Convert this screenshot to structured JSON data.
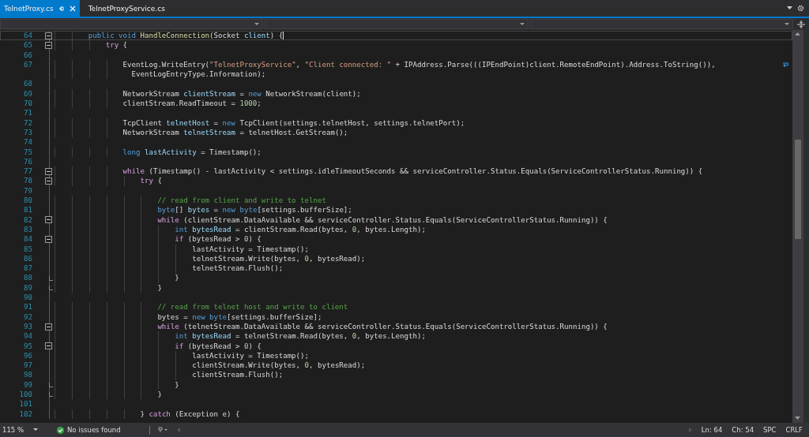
{
  "tabs": [
    {
      "label": "TelnetProxy.cs",
      "selected": true
    },
    {
      "label": "TelnetProxyService.cs",
      "selected": false
    }
  ],
  "editor": {
    "lines": [
      {
        "number": "64",
        "collapsible": true,
        "current": true,
        "tokens": [
          {
            "kind": "keyword",
            "text": "        public void "
          },
          {
            "kind": "method",
            "text": "HandleConnection"
          },
          {
            "kind": "plain",
            "text": "(Socket "
          },
          {
            "kind": "local",
            "text": "client"
          },
          {
            "kind": "plain",
            "text": ") {"
          }
        ]
      },
      {
        "number": "65",
        "collapsible": true,
        "tokens": [
          {
            "kind": "control",
            "text": "            try"
          },
          {
            "kind": "plain",
            "text": " {"
          }
        ]
      },
      {
        "number": "66"
      },
      {
        "number": "67",
        "wrapped": true,
        "tokens": [
          {
            "kind": "plain",
            "text": "                EventLog.WriteEntry("
          },
          {
            "kind": "string",
            "text": "\"TelnetProxyService\""
          },
          {
            "kind": "plain",
            "text": ", "
          },
          {
            "kind": "string",
            "text": "\"Client connected: \""
          },
          {
            "kind": "plain",
            "text": " + IPAddress.Parse(((IPEndPoint)client.RemoteEndPoint).Address.ToString()),"
          }
        ],
        "continuation": "                  EventLogEntryType.Information);"
      },
      {
        "number": "68"
      },
      {
        "number": "69",
        "tokens": [
          {
            "kind": "plain",
            "text": "                NetworkStream "
          },
          {
            "kind": "local",
            "text": "clientStream"
          },
          {
            "kind": "plain",
            "text": " = "
          },
          {
            "kind": "keyword",
            "text": "new"
          },
          {
            "kind": "plain",
            "text": " NetworkStream(client);"
          }
        ]
      },
      {
        "number": "70",
        "tokens": [
          {
            "kind": "plain",
            "text": "                clientStream.ReadTimeout = "
          },
          {
            "kind": "number",
            "text": "1000"
          },
          {
            "kind": "plain",
            "text": ";"
          }
        ]
      },
      {
        "number": "71"
      },
      {
        "number": "72",
        "tokens": [
          {
            "kind": "plain",
            "text": "                TcpClient "
          },
          {
            "kind": "local",
            "text": "telnetHost"
          },
          {
            "kind": "plain",
            "text": " = "
          },
          {
            "kind": "keyword",
            "text": "new"
          },
          {
            "kind": "plain",
            "text": " TcpClient(settings.telnetHost, settings.telnetPort);"
          }
        ]
      },
      {
        "number": "73",
        "tokens": [
          {
            "kind": "plain",
            "text": "                NetworkStream "
          },
          {
            "kind": "local",
            "text": "telnetStream"
          },
          {
            "kind": "plain",
            "text": " = telnetHost.GetStream();"
          }
        ]
      },
      {
        "number": "74"
      },
      {
        "number": "75",
        "tokens": [
          {
            "kind": "keyword",
            "text": "                long "
          },
          {
            "kind": "local",
            "text": "lastActivity"
          },
          {
            "kind": "plain",
            "text": " = Timestamp();"
          }
        ]
      },
      {
        "number": "76"
      },
      {
        "number": "77",
        "collapsible": true,
        "tokens": [
          {
            "kind": "control",
            "text": "                while"
          },
          {
            "kind": "plain",
            "text": " (Timestamp() - lastActivity < settings.idleTimeoutSeconds && serviceController.Status.Equals(ServiceControllerStatus.Running)) {"
          }
        ]
      },
      {
        "number": "78",
        "collapsible": true,
        "tokens": [
          {
            "kind": "control",
            "text": "                    try"
          },
          {
            "kind": "plain",
            "text": " {"
          }
        ]
      },
      {
        "number": "79"
      },
      {
        "number": "80",
        "tokens": [
          {
            "kind": "comment",
            "text": "                        // read from client and write to telnet"
          }
        ]
      },
      {
        "number": "81",
        "tokens": [
          {
            "kind": "keyword",
            "text": "                        byte"
          },
          {
            "kind": "plain",
            "text": "[] "
          },
          {
            "kind": "local",
            "text": "bytes"
          },
          {
            "kind": "plain",
            "text": " = "
          },
          {
            "kind": "keyword",
            "text": "new byte"
          },
          {
            "kind": "plain",
            "text": "[settings.bufferSize];"
          }
        ]
      },
      {
        "number": "82",
        "collapsible": true,
        "tokens": [
          {
            "kind": "control",
            "text": "                        while"
          },
          {
            "kind": "plain",
            "text": " (clientStream.DataAvailable && serviceController.Status.Equals(ServiceControllerStatus.Running)) {"
          }
        ]
      },
      {
        "number": "83",
        "tokens": [
          {
            "kind": "keyword",
            "text": "                            int "
          },
          {
            "kind": "local",
            "text": "bytesRead"
          },
          {
            "kind": "plain",
            "text": " = clientStream.Read(bytes, "
          },
          {
            "kind": "number",
            "text": "0"
          },
          {
            "kind": "plain",
            "text": ", bytes.Length);"
          }
        ]
      },
      {
        "number": "84",
        "collapsible": true,
        "tokens": [
          {
            "kind": "control",
            "text": "                            if"
          },
          {
            "kind": "plain",
            "text": " (bytesRead > "
          },
          {
            "kind": "number",
            "text": "0"
          },
          {
            "kind": "plain",
            "text": ") {"
          }
        ]
      },
      {
        "number": "85",
        "tokens": [
          {
            "kind": "plain",
            "text": "                                lastActivity = Timestamp();"
          }
        ]
      },
      {
        "number": "86",
        "tokens": [
          {
            "kind": "plain",
            "text": "                                telnetStream.Write(bytes, "
          },
          {
            "kind": "number",
            "text": "0"
          },
          {
            "kind": "plain",
            "text": ", bytesRead);"
          }
        ]
      },
      {
        "number": "87",
        "tokens": [
          {
            "kind": "plain",
            "text": "                                telnetStream.Flush();"
          }
        ]
      },
      {
        "number": "88",
        "block_end": true,
        "tokens": [
          {
            "kind": "plain",
            "text": "                            }"
          }
        ]
      },
      {
        "number": "89",
        "block_end": true,
        "tokens": [
          {
            "kind": "plain",
            "text": "                        }"
          }
        ]
      },
      {
        "number": "90"
      },
      {
        "number": "91",
        "tokens": [
          {
            "kind": "comment",
            "text": "                        // read from telnet host and write to client"
          }
        ]
      },
      {
        "number": "92",
        "tokens": [
          {
            "kind": "plain",
            "text": "                        bytes = "
          },
          {
            "kind": "keyword",
            "text": "new byte"
          },
          {
            "kind": "plain",
            "text": "[settings.bufferSize];"
          }
        ]
      },
      {
        "number": "93",
        "collapsible": true,
        "tokens": [
          {
            "kind": "control",
            "text": "                        while"
          },
          {
            "kind": "plain",
            "text": " (telnetStream.DataAvailable && serviceController.Status.Equals(ServiceControllerStatus.Running)) {"
          }
        ]
      },
      {
        "number": "94",
        "tokens": [
          {
            "kind": "keyword",
            "text": "                            int "
          },
          {
            "kind": "local",
            "text": "bytesRead"
          },
          {
            "kind": "plain",
            "text": " = telnetStream.Read(bytes, "
          },
          {
            "kind": "number",
            "text": "0"
          },
          {
            "kind": "plain",
            "text": ", bytes.Length);"
          }
        ]
      },
      {
        "number": "95",
        "collapsible": true,
        "tokens": [
          {
            "kind": "control",
            "text": "                            if"
          },
          {
            "kind": "plain",
            "text": " (bytesRead > "
          },
          {
            "kind": "number",
            "text": "0"
          },
          {
            "kind": "plain",
            "text": ") {"
          }
        ]
      },
      {
        "number": "96",
        "tokens": [
          {
            "kind": "plain",
            "text": "                                lastActivity = Timestamp();"
          }
        ]
      },
      {
        "number": "97",
        "tokens": [
          {
            "kind": "plain",
            "text": "                                clientStream.Write(bytes, "
          },
          {
            "kind": "number",
            "text": "0"
          },
          {
            "kind": "plain",
            "text": ", bytesRead);"
          }
        ]
      },
      {
        "number": "98",
        "tokens": [
          {
            "kind": "plain",
            "text": "                                clientStream.Flush();"
          }
        ]
      },
      {
        "number": "99",
        "block_end": true,
        "tokens": [
          {
            "kind": "plain",
            "text": "                            }"
          }
        ]
      },
      {
        "number": "100",
        "block_end": true,
        "tokens": [
          {
            "kind": "plain",
            "text": "                        }"
          }
        ]
      },
      {
        "number": "101"
      },
      {
        "number": "102",
        "tokens": [
          {
            "kind": "plain",
            "text": "                    } "
          },
          {
            "kind": "control",
            "text": "catch"
          },
          {
            "kind": "plain",
            "text": " (Exception e) {"
          }
        ]
      }
    ]
  },
  "status_bar": {
    "zoom": "115 %",
    "issues": "No issues found",
    "line": "Ln: 64",
    "column": "Ch: 54",
    "indentation": "SPC",
    "line_endings": "CRLF"
  }
}
